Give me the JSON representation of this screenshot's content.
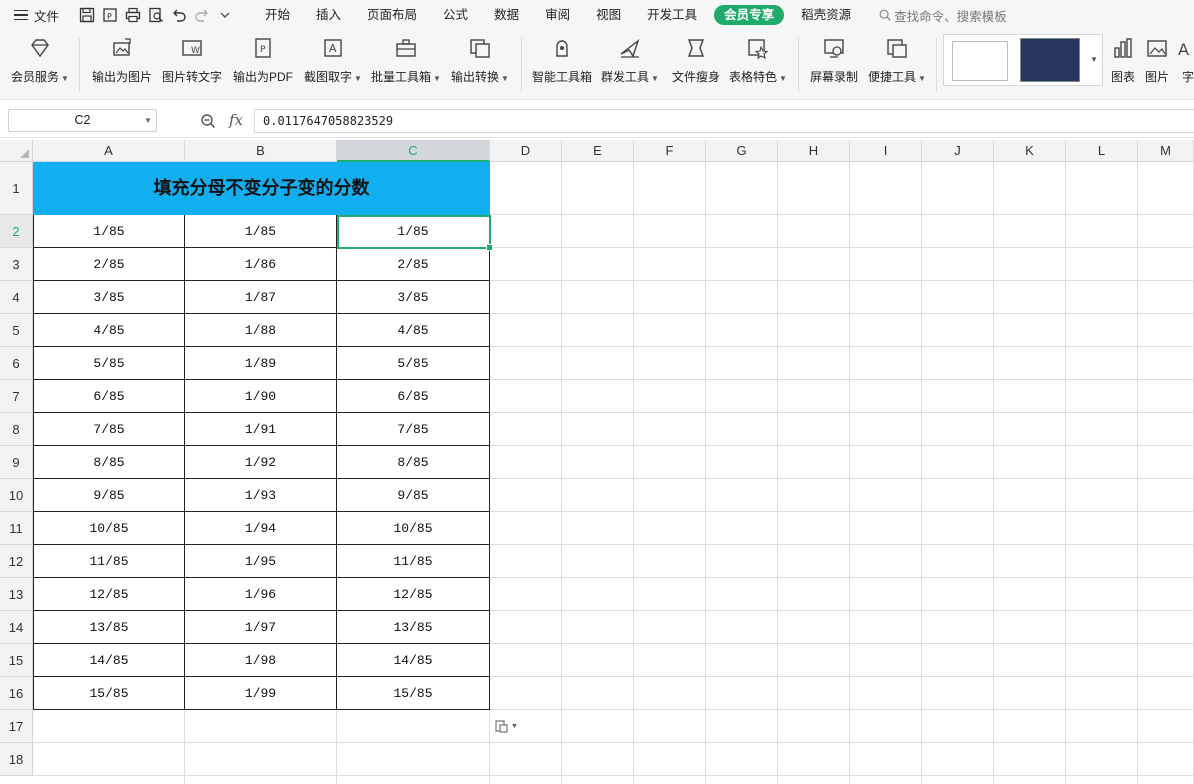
{
  "menubar": {
    "file_label": "文件",
    "tabs": [
      "开始",
      "插入",
      "页面布局",
      "公式",
      "数据",
      "审阅",
      "视图",
      "开发工具",
      "会员专享",
      "稻壳资源"
    ],
    "active_tab": "会员专享",
    "search_placeholder": "查找命令、搜索模板"
  },
  "ribbon": {
    "buttons": [
      {
        "label": "会员服务",
        "icon": "diamond-icon",
        "dropdown": true
      },
      {
        "label": "输出为图片",
        "icon": "export-image-icon",
        "dropdown": false
      },
      {
        "label": "图片转文字",
        "icon": "image-to-text-icon",
        "dropdown": false
      },
      {
        "label": "输出为PDF",
        "icon": "export-pdf-icon",
        "dropdown": false
      },
      {
        "label": "截图取字",
        "icon": "screenshot-text-icon",
        "dropdown": true
      },
      {
        "label": "批量工具箱",
        "icon": "toolbox-icon",
        "dropdown": true
      },
      {
        "label": "输出转换",
        "icon": "convert-icon",
        "dropdown": true
      },
      {
        "label": "智能工具箱",
        "icon": "smart-toolbox-icon",
        "dropdown": false
      },
      {
        "label": "群发工具",
        "icon": "mass-send-icon",
        "dropdown": true
      },
      {
        "label": "文件瘦身",
        "icon": "file-slim-icon",
        "dropdown": false
      },
      {
        "label": "表格特色",
        "icon": "table-feature-icon",
        "dropdown": true
      },
      {
        "label": "屏幕录制",
        "icon": "screen-record-icon",
        "dropdown": false
      },
      {
        "label": "便捷工具",
        "icon": "handy-tools-icon",
        "dropdown": true
      },
      {
        "label": "图表",
        "icon": "chart-icon",
        "dropdown": false
      },
      {
        "label": "图片",
        "icon": "picture-icon",
        "dropdown": false
      },
      {
        "label": "字",
        "icon": "text-icon",
        "dropdown": false
      }
    ]
  },
  "formula": {
    "cell_ref": "C2",
    "fx": "fx",
    "value": "0.0117647058823529"
  },
  "sheet": {
    "columns": [
      "A",
      "B",
      "C",
      "D",
      "E",
      "F",
      "G",
      "H",
      "I",
      "J",
      "K",
      "L",
      "M"
    ],
    "selected_column": "C",
    "rows": [
      "1",
      "2",
      "3",
      "4",
      "5",
      "6",
      "7",
      "8",
      "9",
      "10",
      "11",
      "12",
      "13",
      "14",
      "15",
      "16",
      "17",
      "18"
    ],
    "selected_row": "2",
    "title": "填充分母不变分子变的分数",
    "data": [
      [
        "1/85",
        "1/85",
        "1/85"
      ],
      [
        "2/85",
        "1/86",
        "2/85"
      ],
      [
        "3/85",
        "1/87",
        "3/85"
      ],
      [
        "4/85",
        "1/88",
        "4/85"
      ],
      [
        "5/85",
        "1/89",
        "5/85"
      ],
      [
        "6/85",
        "1/90",
        "6/85"
      ],
      [
        "7/85",
        "1/91",
        "7/85"
      ],
      [
        "8/85",
        "1/92",
        "8/85"
      ],
      [
        "9/85",
        "1/93",
        "9/85"
      ],
      [
        "10/85",
        "1/94",
        "10/85"
      ],
      [
        "11/85",
        "1/95",
        "11/85"
      ],
      [
        "12/85",
        "1/96",
        "12/85"
      ],
      [
        "13/85",
        "1/97",
        "13/85"
      ],
      [
        "14/85",
        "1/98",
        "14/85"
      ],
      [
        "15/85",
        "1/99",
        "15/85"
      ]
    ]
  },
  "colors": {
    "accent": "#1fac6a",
    "title_fill": "#12aff0"
  }
}
